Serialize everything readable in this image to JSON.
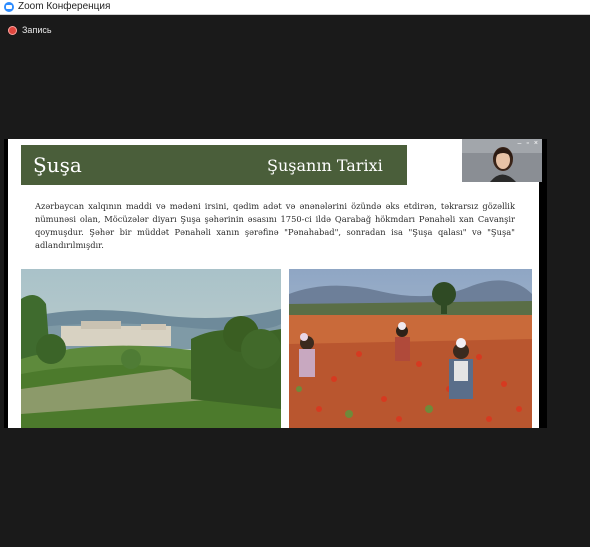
{
  "window": {
    "title": "Zoom Конференция"
  },
  "recording": {
    "label": "Запись",
    "icon": "record-icon"
  },
  "slide": {
    "title_left": "Şuşa",
    "title_right": "Şuşanın Tarixi",
    "paragraph": "Azərbaycan xalqının maddi və mədəni irsini, qədim adət və ənənələrini özündə əks etdirən, təkrarsız gözəllik nümunəsi olan, Möcüzələr diyarı Şuşa şəhərinin əsasını 1750-ci ildə Qarabağ hökmdarı Pənahəli xan Cavanşir qoymuşdur. Şəhər bir müddət Pənahəli xanın şərəfinə \"Pənahabad\", sonradan isa \"Şuşa qalası\" və \"Şuşa\" adlandırılmışdır.",
    "header_color": "#4a5e3a"
  },
  "window_controls": {
    "minimize": "–",
    "restore": "▫",
    "close": "×"
  },
  "colors": {
    "app_background": "#1a1a1a",
    "record": "#e0463e",
    "zoom_blue": "#2d8cff"
  }
}
